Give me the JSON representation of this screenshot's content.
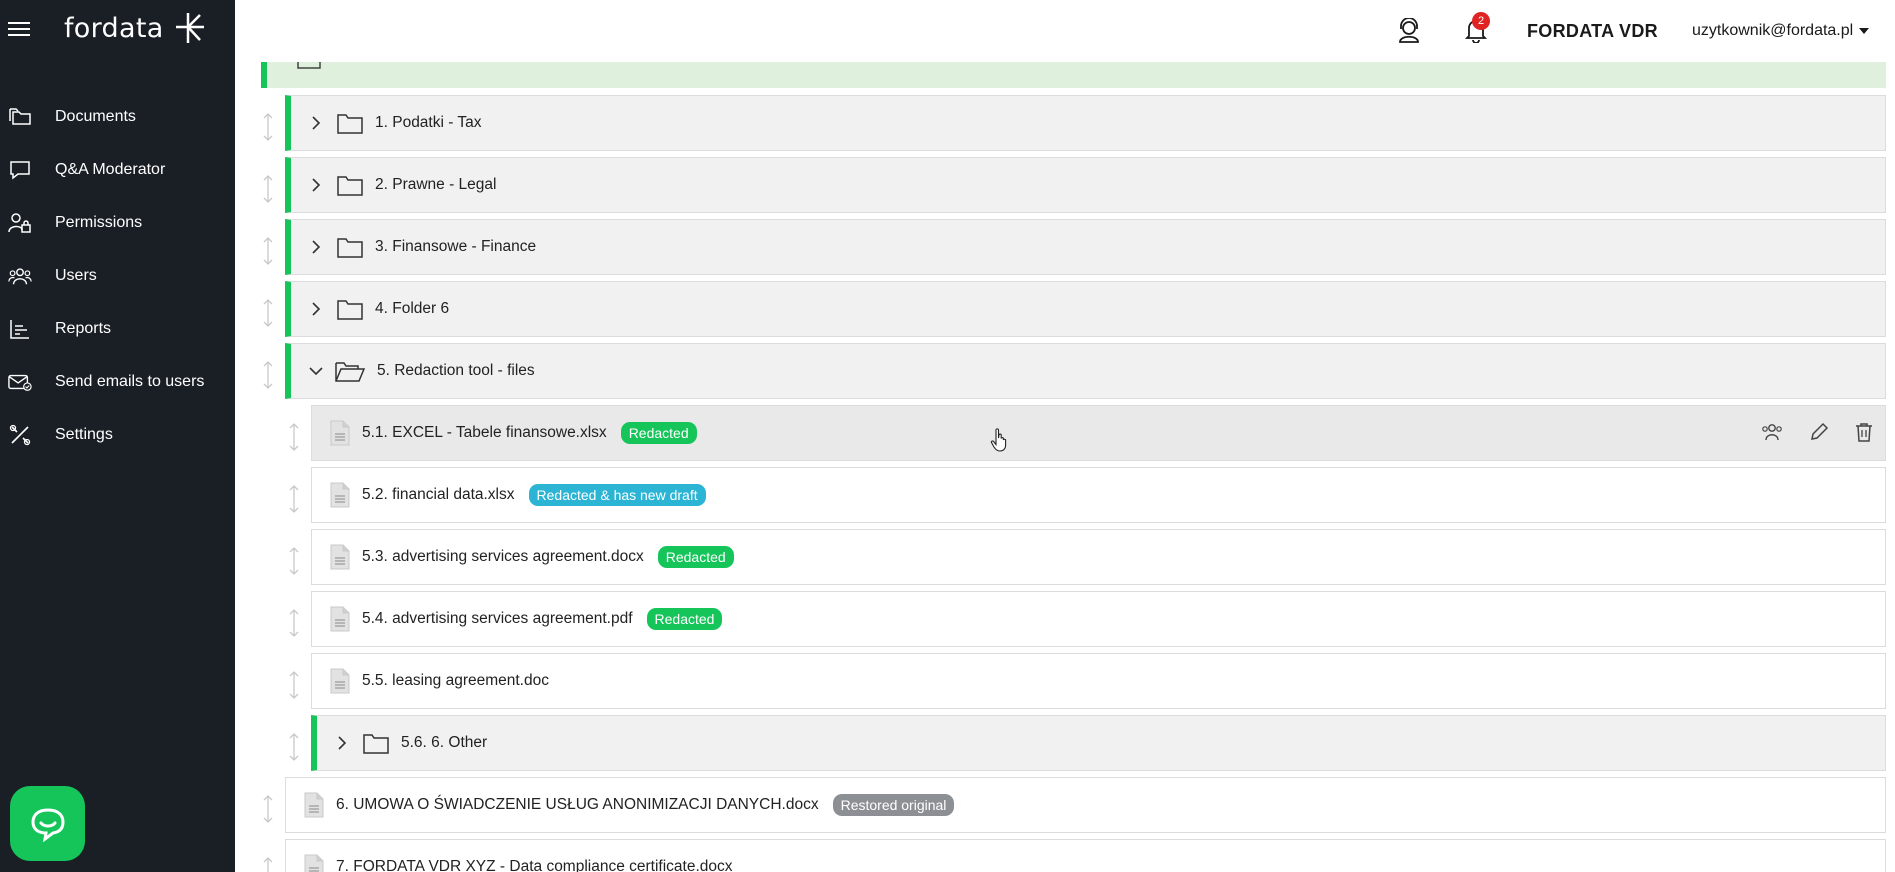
{
  "app": {
    "logo_text": "fordata",
    "brand_color": "#16c55a",
    "sidebar_bg": "#1a1f26"
  },
  "sidebar": {
    "items": [
      {
        "label": "Documents",
        "icon": "folders-icon"
      },
      {
        "label": "Q&A Moderator",
        "icon": "chat-bubble-icon"
      },
      {
        "label": "Permissions",
        "icon": "user-lock-icon"
      },
      {
        "label": "Users",
        "icon": "users-icon"
      },
      {
        "label": "Reports",
        "icon": "report-chart-icon"
      },
      {
        "label": "Send emails to users",
        "icon": "email-icon"
      },
      {
        "label": "Settings",
        "icon": "tools-icon"
      }
    ]
  },
  "header": {
    "notification_count": "2",
    "vdr_name": "FORDATA VDR",
    "user_email": "uzytkownik@fordata.pl"
  },
  "tree": {
    "folders": [
      {
        "label": "1. Podatki - Tax"
      },
      {
        "label": "2. Prawne - Legal"
      },
      {
        "label": "3. Finansowe - Finance"
      },
      {
        "label": "4. Folder 6"
      },
      {
        "label": "5. Redaction tool - files"
      }
    ],
    "files": [
      {
        "label": "5.1. EXCEL - Tabele finansowe.xlsx",
        "badge": "Redacted"
      },
      {
        "label": "5.2. financial data.xlsx",
        "badge": "Redacted & has new draft"
      },
      {
        "label": "5.3. advertising services agreement.docx",
        "badge": "Redacted"
      },
      {
        "label": "5.4. advertising services agreement.pdf",
        "badge": "Redacted"
      },
      {
        "label": "5.5. leasing agreement.doc"
      }
    ],
    "subfolder": {
      "label": "5.6. 6. Other"
    },
    "root_files": [
      {
        "label": "6. UMOWA O ŚWIADCZENIE USŁUG ANONIMIZACJI DANYCH.docx",
        "badge": "Restored original"
      },
      {
        "label": "7. FORDATA VDR XYZ - Data compliance certificate.docx"
      }
    ]
  }
}
